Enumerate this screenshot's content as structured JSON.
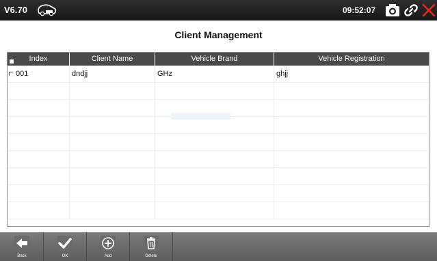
{
  "topbar": {
    "version": "V6.70",
    "time": "09:52:07",
    "logo_icon": "car-vin-icon",
    "camera_icon": "camera-icon",
    "link_icon": "link-icon",
    "close_icon": "close-icon",
    "accent_close": "#e8261f"
  },
  "page": {
    "title": "Client Management"
  },
  "table": {
    "columns": [
      "Index",
      "Client Name",
      "Vehicle Brand",
      "Vehicle Registration"
    ],
    "rows": [
      {
        "index": "001",
        "client_name": "dndjj",
        "vehicle_brand": "GHz",
        "vehicle_registration": "ghjj"
      }
    ]
  },
  "toolbar": {
    "back_label": "Back",
    "ok_label": "OK",
    "add_label": "Add",
    "delete_label": "Delete"
  }
}
